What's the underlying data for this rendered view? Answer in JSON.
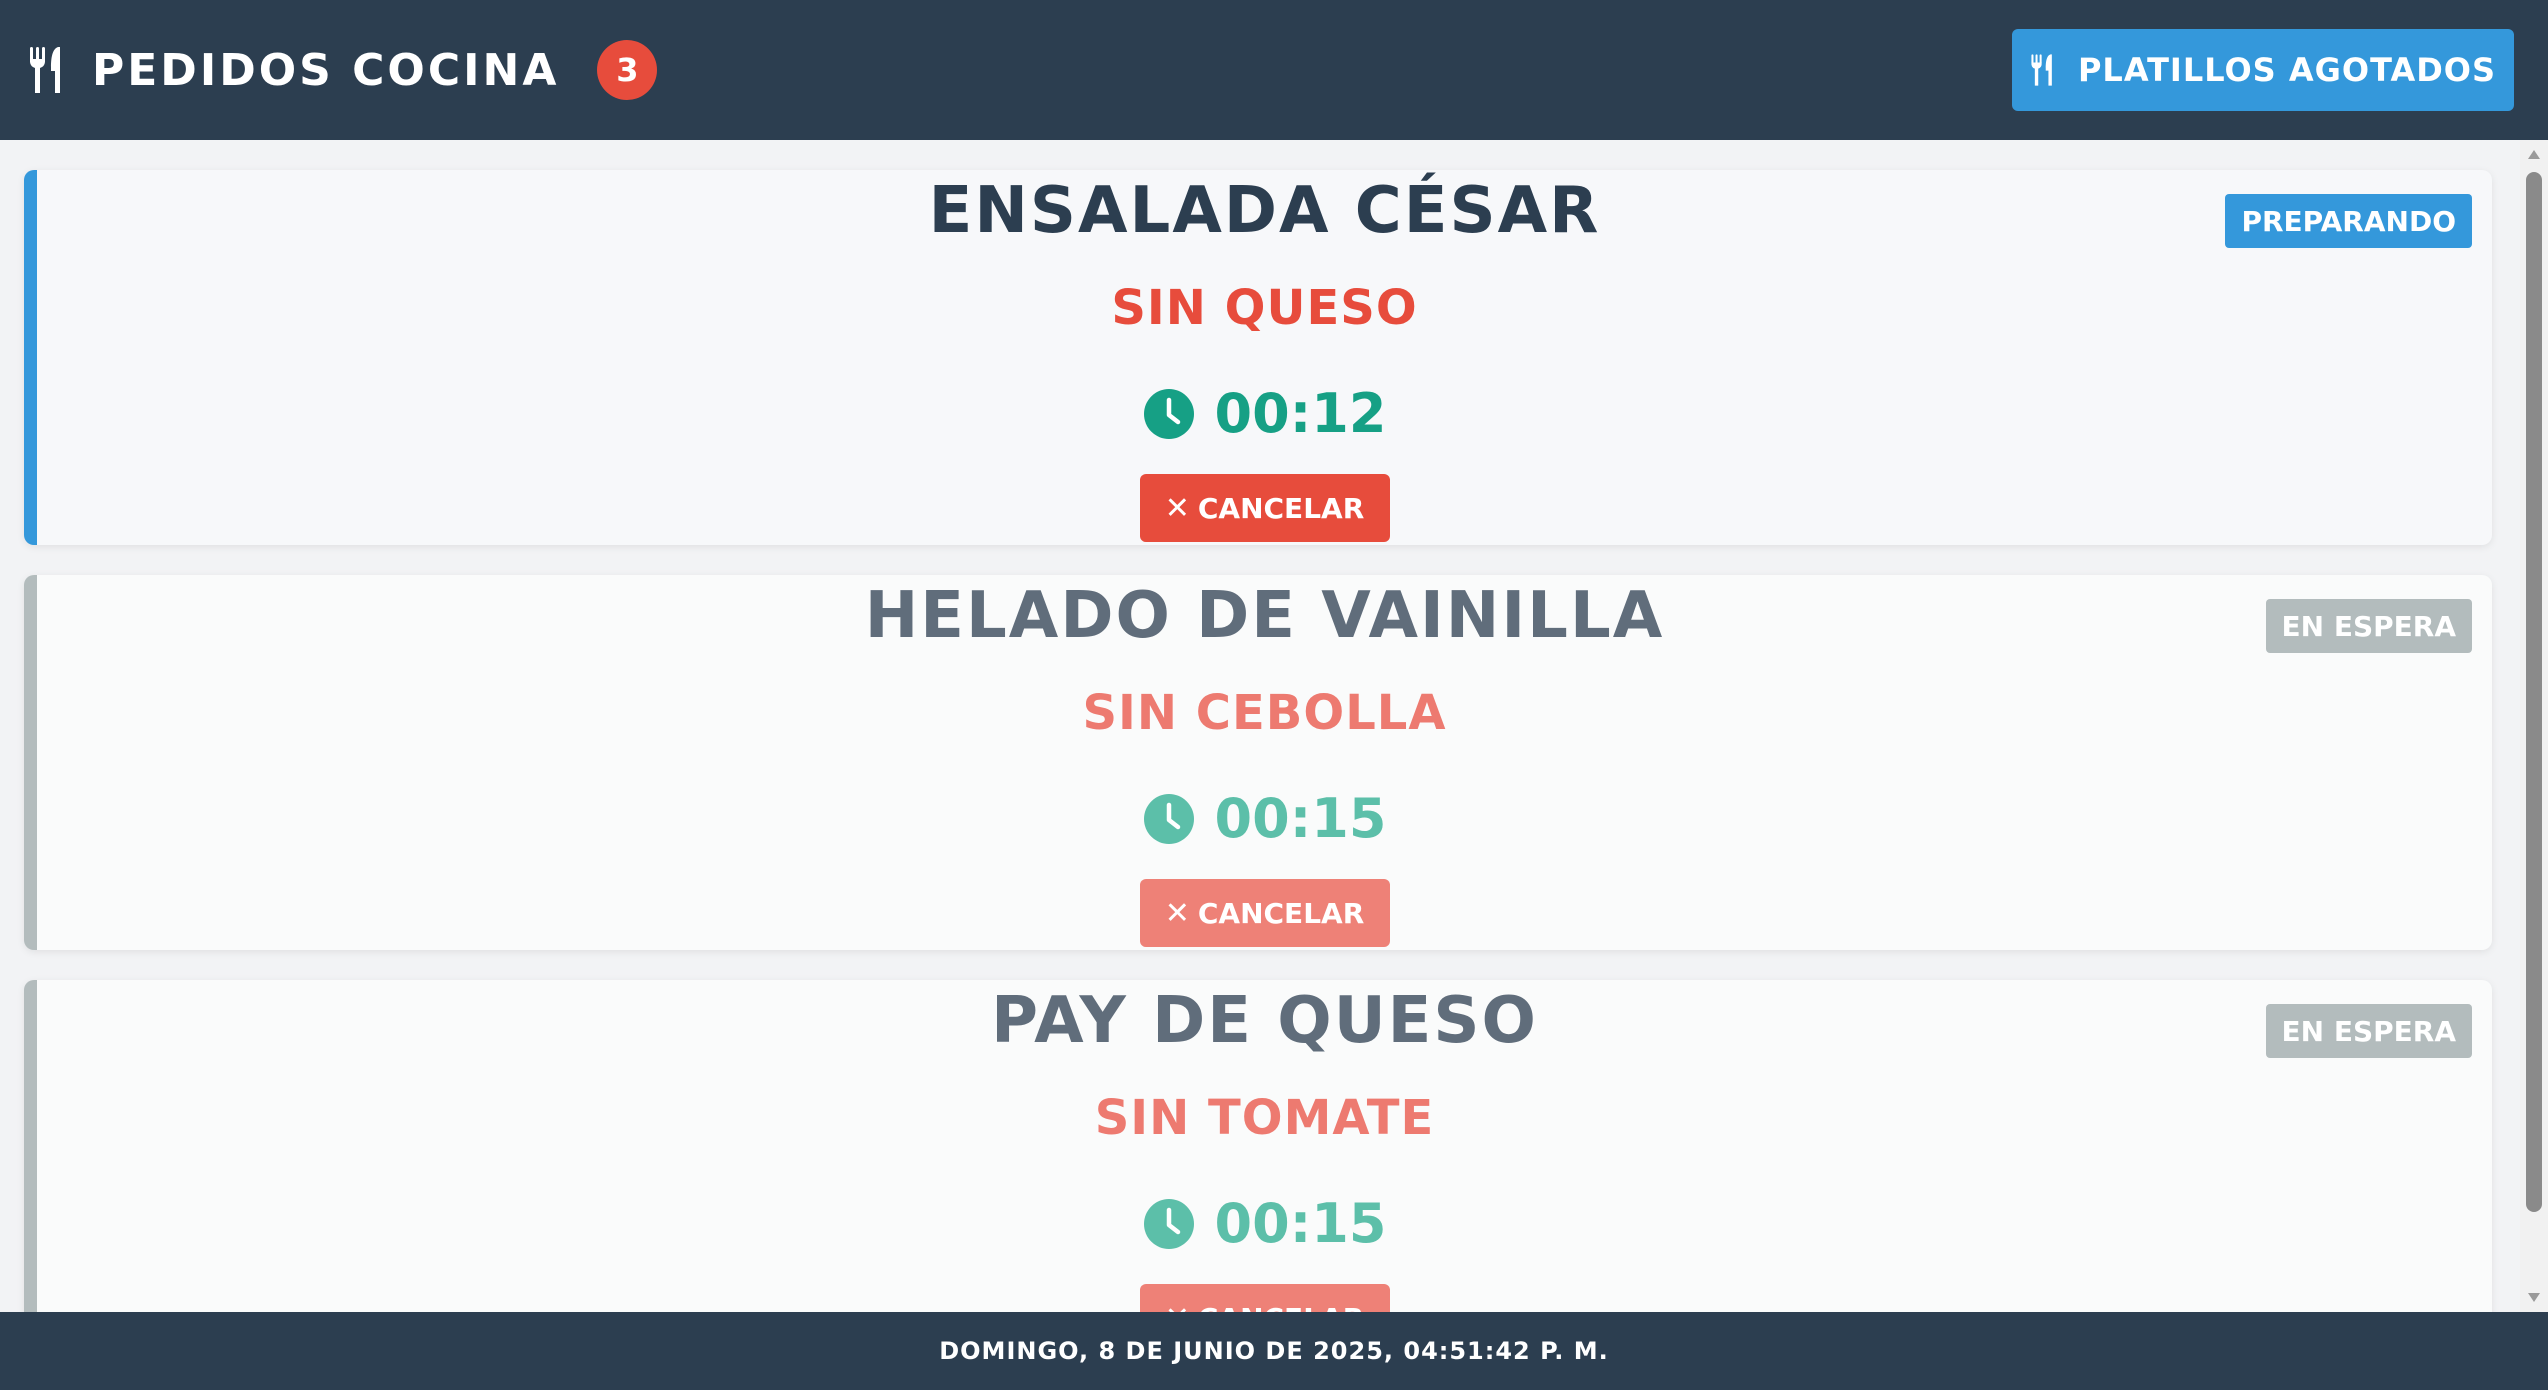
{
  "header": {
    "title": "PEDIDOS COCINA",
    "order_count": "3",
    "sold_out_label": "PLATILLOS AGOTADOS",
    "icon": "utensils-icon",
    "background": "#2c3e50",
    "accent": "#3498db",
    "badge_color": "#e74c3c"
  },
  "orders": [
    {
      "dish": "ENSALADA CÉSAR",
      "note": "SIN QUESO",
      "timer": "00:12",
      "status": "PREPARANDO",
      "cancel_label": "CANCELAR",
      "state": "preparing"
    },
    {
      "dish": "HELADO DE VAINILLA",
      "note": "SIN CEBOLLA",
      "timer": "00:15",
      "status": "EN ESPERA",
      "cancel_label": "CANCELAR",
      "state": "waiting"
    },
    {
      "dish": "PAY DE QUESO",
      "note": "SIN TOMATE",
      "timer": "00:15",
      "status": "EN ESPERA",
      "cancel_label": "CANCELAR",
      "state": "waiting"
    }
  ],
  "footer": {
    "datetime": "DOMINGO, 8 DE JUNIO DE 2025, 04:51:42 P. M."
  },
  "colors": {
    "preparing": "#3498db",
    "waiting": "#b3bcbd",
    "timer": "#16a085",
    "cancel": "#e74c3c"
  }
}
